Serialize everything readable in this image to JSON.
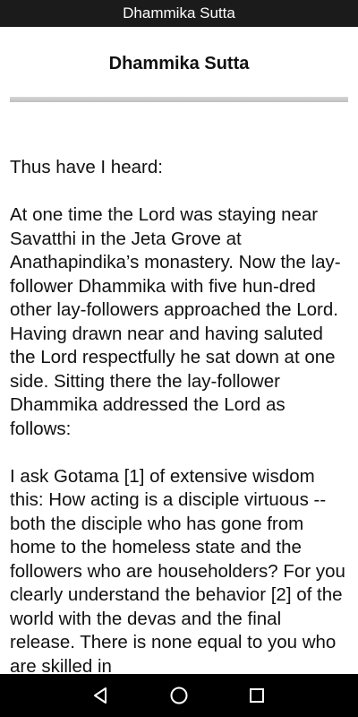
{
  "app": {
    "title": "Dhammika Sutta"
  },
  "page": {
    "heading": "Dhammika Sutta"
  },
  "content": {
    "paragraphs": [
      "Thus have I heard:",
      "At one time the Lord was staying near Savatthi in the Jeta Grove at Anathapindika’s monastery. Now the lay-follower Dhammika with five hun-dred other lay-followers approached the Lord. Having drawn near and having saluted the Lord respectfully he sat down at one side. Sitting there the lay-follower Dhammika addressed the Lord as follows:",
      "I ask Gotama [1] of extensive wisdom this: How acting is a disciple virtuous -- both the disciple who has gone from home to the homeless state and the followers who are householders? For you clearly understand the behavior [2] of the world with the devas and the final release. There is none equal to you who are skilled in"
    ]
  },
  "navigation": {
    "back_icon": "back-triangle-icon",
    "home_icon": "home-circle-icon",
    "recents_icon": "recents-square-icon"
  }
}
